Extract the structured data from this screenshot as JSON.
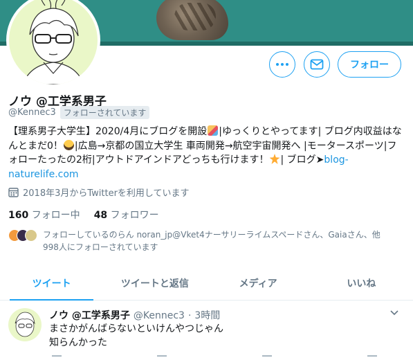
{
  "profile": {
    "name": "ノウ @工学系男子",
    "handle": "@Kennec3",
    "follows_you_badge": "フォローされています",
    "bio": {
      "part1": "【理系男子大学生】2020/4月にブログを開設",
      "emoji1": "party-popper-emoji",
      "part2": "|ゆっくりとやってます| ブログ内収益はなんとまだ0！",
      "emoji2": "scream-emoji",
      "part3": "|広島→京都の国立大学生 車両開発→航空宇宙開発へ |モータースポーツ|フォローたったの2桁|アウトドアインドアどっちも行けます！",
      "emoji3": "star-emoji",
      "part4": "| ブログ➤",
      "link": "blog-naturelife.com"
    },
    "joined": "2018年3月からTwitterを利用しています",
    "following_count": "160",
    "following_label": "フォロー中",
    "followers_count": "48",
    "followers_label": "フォロワー",
    "followed_by": "フォローしているのらん noran_jp@Vket4ナーサリーライムスペードさん、Gaiaさん、他998人にフォローされています"
  },
  "actions": {
    "more_icon": "more-dots-icon",
    "message_icon": "envelope-icon",
    "follow_label": "フォロー"
  },
  "tabs": [
    {
      "label": "ツイート",
      "active": true
    },
    {
      "label": "ツイートと返信",
      "active": false
    },
    {
      "label": "メディア",
      "active": false
    },
    {
      "label": "いいね",
      "active": false
    }
  ],
  "tweet": {
    "name": "ノウ @工学系男子",
    "handle": "@Kennec3",
    "separator": "·",
    "time": "3時間",
    "text": "まさかがんばらないといけんやつじゃん\n知らんかった"
  },
  "colors": {
    "accent": "#1da1f2",
    "muted": "#657786",
    "banner": "#2f8e86",
    "avatar_bg": "#eaf7c8"
  }
}
